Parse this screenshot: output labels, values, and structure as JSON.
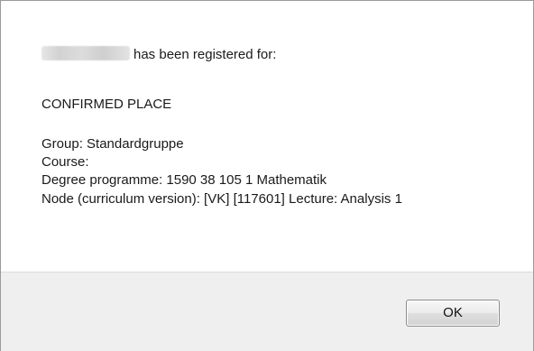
{
  "dialog": {
    "message_suffix": "has been registered for:",
    "status": "CONFIRMED PLACE",
    "details": [
      "Group: Standardgruppe",
      "Course:",
      "Degree programme: 1590 38 105 1 Mathematik",
      "Node (curriculum version): [VK]  [117601] Lecture: Analysis 1"
    ]
  },
  "footer": {
    "ok_label": "OK"
  }
}
